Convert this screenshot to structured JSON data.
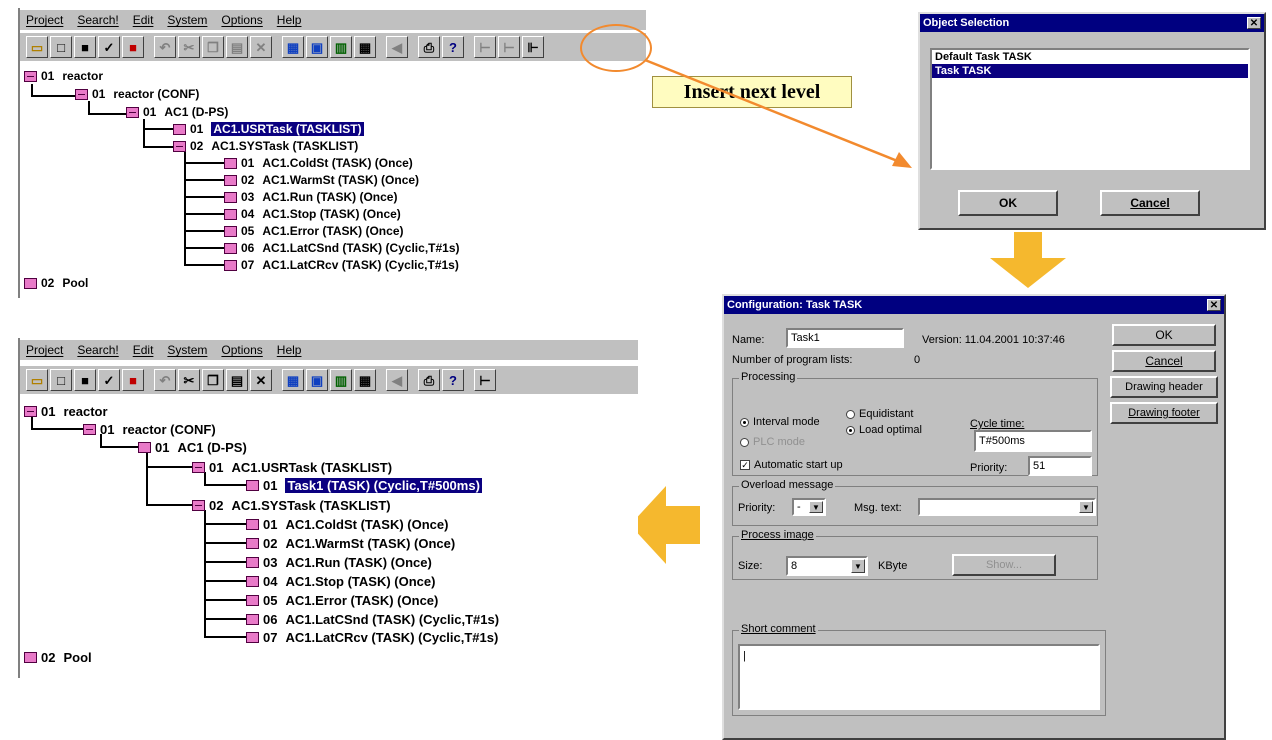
{
  "menu": [
    "Project",
    "Search!",
    "Edit",
    "System",
    "Options",
    "Help"
  ],
  "callout": "Insert next level",
  "tree_top": {
    "nodes": [
      {
        "num": "01",
        "label": "reactor"
      },
      {
        "num": "01",
        "label": "reactor  (CONF)"
      },
      {
        "num": "01",
        "label": "AC1  (D-PS)"
      },
      {
        "num": "01",
        "label": "AC1.USRTask  (TASKLIST)"
      },
      {
        "num": "02",
        "label": "AC1.SYSTask  (TASKLIST)"
      },
      {
        "num": "01",
        "label": "AC1.ColdSt  (TASK) (Once)"
      },
      {
        "num": "02",
        "label": "AC1.WarmSt  (TASK) (Once)"
      },
      {
        "num": "03",
        "label": "AC1.Run  (TASK) (Once)"
      },
      {
        "num": "04",
        "label": "AC1.Stop  (TASK) (Once)"
      },
      {
        "num": "05",
        "label": "AC1.Error  (TASK) (Once)"
      },
      {
        "num": "06",
        "label": "AC1.LatCSnd  (TASK) (Cyclic,T#1s)"
      },
      {
        "num": "07",
        "label": "AC1.LatCRcv  (TASK) (Cyclic,T#1s)"
      },
      {
        "num": "02",
        "label": "Pool"
      }
    ]
  },
  "tree_bottom": {
    "nodes": [
      {
        "num": "01",
        "label": "reactor"
      },
      {
        "num": "01",
        "label": "reactor  (CONF)"
      },
      {
        "num": "01",
        "label": "AC1  (D-PS)"
      },
      {
        "num": "01",
        "label": "AC1.USRTask  (TASKLIST)"
      },
      {
        "num": "01",
        "label": "Task1  (TASK)  (Cyclic,T#500ms)"
      },
      {
        "num": "02",
        "label": "AC1.SYSTask  (TASKLIST)"
      },
      {
        "num": "01",
        "label": "AC1.ColdSt  (TASK) (Once)"
      },
      {
        "num": "02",
        "label": "AC1.WarmSt  (TASK) (Once)"
      },
      {
        "num": "03",
        "label": "AC1.Run  (TASK) (Once)"
      },
      {
        "num": "04",
        "label": "AC1.Stop  (TASK) (Once)"
      },
      {
        "num": "05",
        "label": "AC1.Error  (TASK) (Once)"
      },
      {
        "num": "06",
        "label": "AC1.LatCSnd  (TASK) (Cyclic,T#1s)"
      },
      {
        "num": "07",
        "label": "AC1.LatCRcv  (TASK) (Cyclic,T#1s)"
      },
      {
        "num": "02",
        "label": "Pool"
      }
    ]
  },
  "object_selection": {
    "title": "Object Selection",
    "items": [
      "Default Task TASK",
      "Task TASK"
    ],
    "ok": "OK",
    "cancel": "Cancel"
  },
  "config": {
    "title": "Configuration: Task TASK",
    "name_label": "Name:",
    "name_value": "Task1",
    "version": "Version:  11.04.2001 10:37:46",
    "num_lists_label": "Number of program lists:",
    "num_lists_value": "0",
    "processing": "Processing",
    "interval_mode": "Interval mode",
    "equidistant": "Equidistant",
    "load_optimal": "Load optimal",
    "plc_mode": "PLC mode",
    "cycle_time_label": "Cycle time:",
    "cycle_time_value": "T#500ms",
    "auto_start": "Automatic start up",
    "priority_label": "Priority:",
    "priority_value": "51",
    "overload": "Overload message",
    "overload_priority_label": "Priority:",
    "overload_priority_value": "-",
    "msg_text_label": "Msg. text:",
    "process_image": "Process image",
    "size_label": "Size:",
    "size_value": "8",
    "kbyte": "KByte",
    "show": "Show...",
    "short_comment": "Short comment",
    "ok": "OK",
    "cancel": "Cancel",
    "drawing_header": "Drawing header",
    "drawing_footer": "Drawing footer"
  },
  "colors": {
    "accent_orange": "#f28a2e",
    "arrow_yellow": "#f5b82e",
    "callout_bg": "#fffcc0",
    "selection": "#0a0080",
    "node_pink": "#e87ac8"
  }
}
